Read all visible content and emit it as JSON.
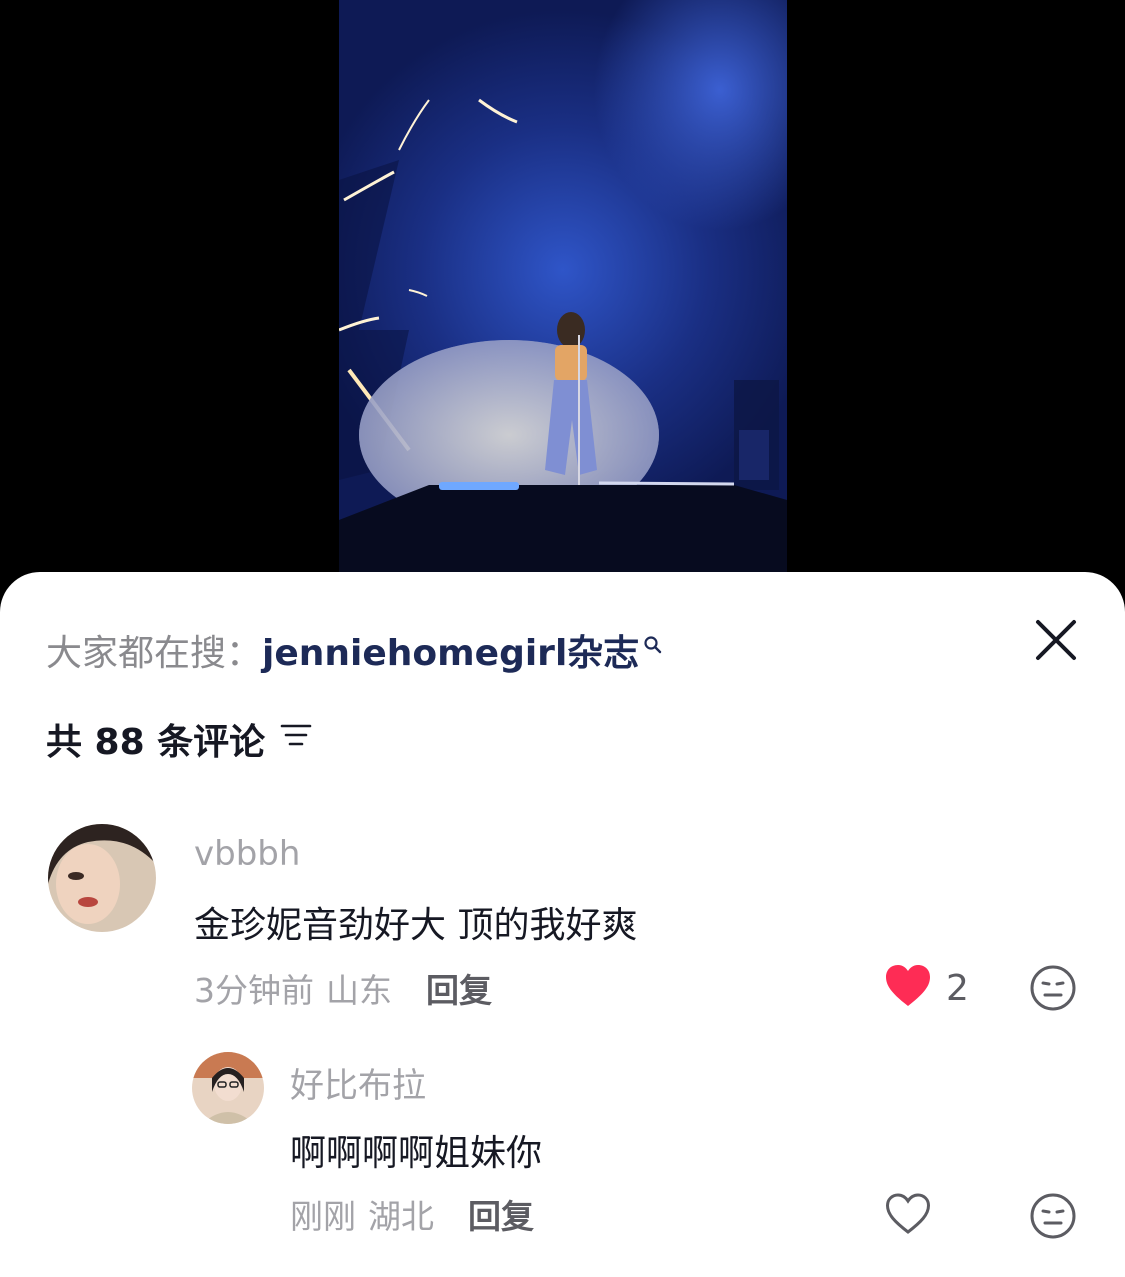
{
  "video": {
    "description_icon": "concert-video-frame"
  },
  "sheet": {
    "search_prefix": "大家都在搜：",
    "search_term": "jenniehomegirl杂志",
    "comment_count_label": "共 88 条评论"
  },
  "comments": [
    {
      "username": "vbbbh",
      "text": "金珍妮音劲好大 顶的我好爽",
      "time": "3分钟前",
      "location": "山东",
      "reply_label": "回复",
      "likes": "2",
      "liked": true
    },
    {
      "username": "好比布拉",
      "text": "啊啊啊啊姐妹你",
      "time": "刚刚",
      "location": "湖北",
      "reply_label": "回复",
      "likes": "",
      "liked": false
    }
  ],
  "colors": {
    "accent_like": "#fe2c55",
    "search_term": "#1d2a57",
    "muted": "#a3a3a8"
  }
}
